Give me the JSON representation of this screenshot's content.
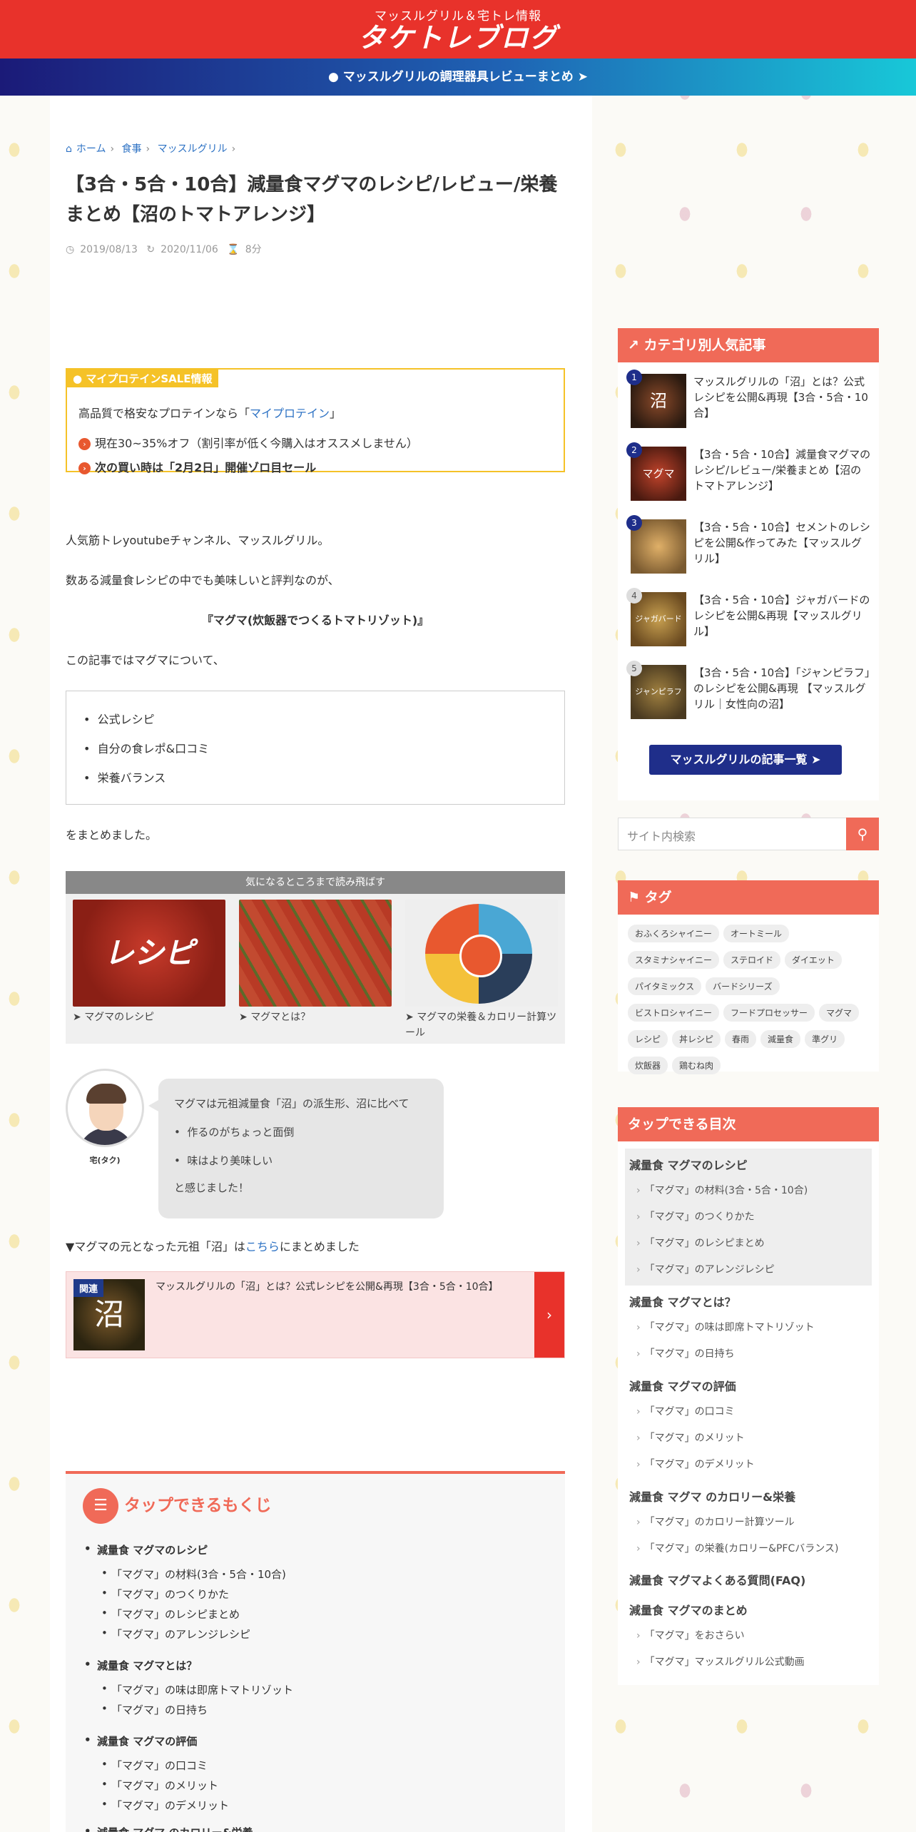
{
  "site": {
    "tagline": "マッスルグリル＆宅トレ情報",
    "logo": "タケトレブログ"
  },
  "notice": {
    "text": "マッスルグリルの調理器具レビューまとめ",
    "bulb": "lightbulb-icon",
    "arrow": "arrow-circle-icon"
  },
  "breadcrumb": {
    "home": "ホーム",
    "c1": "食事",
    "c2": "マッスルグリル"
  },
  "post": {
    "title": "【3合・5合・10合】減量食マグマのレシピ/レビュー/栄養まとめ【沼のトマトアレンジ】",
    "published": "2019/08/13",
    "updated": "2020/11/06",
    "read_time": "8分"
  },
  "sale": {
    "head": "マイプロテインSALE情報",
    "line1_pre": "高品質で格安なプロテインなら「",
    "line1_link": "マイプロテイン",
    "line1_post": "」",
    "item1": "現在30~35%オフ（割引率が低く今購入はオススメしません）",
    "item2": "次の買い時は「2月2日」開催ゾロ目セール"
  },
  "body": {
    "p1": "人気筋トレyoutubeチャンネル、マッスルグリル。",
    "p2": "数ある減量食レシピの中でも美味しいと評判なのが、",
    "p3": "『マグマ(炊飯器でつくるトマトリゾット)』",
    "p4": "この記事ではマグマについて、",
    "b1": "公式レシピ",
    "b2": "自分の食レポ&口コミ",
    "b3": "栄養バランス",
    "p5": "をまとめました。",
    "p6_pre": "▼マグマの元となった元祖「沼」は",
    "p6_link": "こちら",
    "p6_post": "にまとめました"
  },
  "jump": {
    "bar": "気になるところまで読み飛ばす",
    "c1_img": "レシピ",
    "c1": "マグマのレシピ",
    "c2": "マグマとは？",
    "c3": "マグマの栄養＆カロリー計算ツール"
  },
  "author": {
    "name": "宅(タク)",
    "b1": "マグマは元祖減量食「沼」の派生形、沼に比べて",
    "b2": "作るのがちょっと面倒",
    "b3": "味はより美味しい",
    "b4": "と感じました！"
  },
  "related": {
    "badge": "関連",
    "thumb": "沼",
    "text": "マッスルグリルの「沼」とは？公式レシピを公開&再現【3合・5合・10合】"
  },
  "toc": {
    "title": "タップできるもくじ",
    "items": [
      "減量食 マグマのレシピ",
      "「マグマ」の材料(3合・5合・10合)",
      "「マグマ」のつくりかた",
      "「マグマ」のレシピまとめ",
      "「マグマ」のアレンジレシピ",
      "減量食 マグマとは？",
      "「マグマ」の味は即席トマトリゾット",
      "「マグマ」の日持ち",
      "減量食 マグマの評価",
      "「マグマ」の口コミ",
      "「マグマ」のメリット",
      "「マグマ」のデメリット",
      "減量食 マグマ のカロリー&栄養"
    ]
  },
  "popular": {
    "title": "カテゴリ別人気記事",
    "items": [
      {
        "n": "1",
        "img": "沼",
        "t": "マッスルグリルの「沼」とは？公式レシピを公開&再現【3合・5合・10合】"
      },
      {
        "n": "2",
        "img": "マグマ",
        "t": "【3合・5合・10合】減量食マグマのレシピ/レビュー/栄養まとめ【沼のトマトアレンジ】"
      },
      {
        "n": "3",
        "img": "",
        "t": "【3合・5合・10合】セメントのレシピを公開&作ってみた【マッスルグリル】"
      },
      {
        "n": "4",
        "img": "ジャガバード",
        "t": "【3合・5合・10合】ジャガバードのレシピを公開&再現【マッスルグリル】"
      },
      {
        "n": "5",
        "img": "ジャンピラフ",
        "t": "【3合・5合・10合】「ジャンピラフ」のレシピを公開&再現 【マッスルグリル｜女性向の沼】"
      }
    ],
    "button": "マッスルグリルの記事一覧"
  },
  "search": {
    "placeholder": "サイト内検索"
  },
  "tags": {
    "title": "タグ",
    "items": [
      "おふくろシャイニー",
      "オートミール",
      "スタミナシャイニー",
      "ステロイド",
      "ダイエット",
      "パイタミックス",
      "バードシリーズ",
      "ビストロシャイニー",
      "フードプロセッサー",
      "マグマ",
      "レシピ",
      "丼レシピ",
      "春雨",
      "減量食",
      "準グリ",
      "炊飯器",
      "鶏むね肉"
    ]
  },
  "sidetoc": {
    "title": "タップできる目次",
    "items": [
      "減量食 マグマのレシピ",
      "「マグマ」の材料(3合・5合・10合)",
      "「マグマ」のつくりかた",
      "「マグマ」のレシピまとめ",
      "「マグマ」のアレンジレシピ",
      "減量食 マグマとは？",
      "「マグマ」の味は即席トマトリゾット",
      "「マグマ」の日持ち",
      "減量食 マグマの評価",
      "「マグマ」の口コミ",
      "「マグマ」のメリット",
      "「マグマ」のデメリット",
      "減量食 マグマ のカロリー&栄養",
      "「マグマ」のカロリー計算ツール",
      "「マグマ」の栄養(カロリー&PFCバランス)",
      "減量食 マグマよくある質問(FAQ)",
      "減量食 マグマのまとめ",
      "「マグマ」をおさらい",
      "「マグマ」マッスルグリル公式動画"
    ]
  }
}
